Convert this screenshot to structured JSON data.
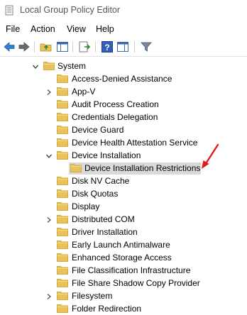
{
  "window": {
    "title": "Local Group Policy Editor"
  },
  "menu": [
    "File",
    "Action",
    "View",
    "Help"
  ],
  "toolbar": {
    "buttons": [
      "back-icon",
      "forward-icon",
      "up-folder-icon",
      "show-hide-tree-icon",
      "export-list-icon",
      "help-icon",
      "properties-pane-icon",
      "filter-icon"
    ]
  },
  "tree": {
    "root": {
      "label": "System",
      "expanded": true
    },
    "items": [
      {
        "label": "Access-Denied Assistance",
        "expandable": false
      },
      {
        "label": "App-V",
        "expandable": true
      },
      {
        "label": "Audit Process Creation",
        "expandable": false
      },
      {
        "label": "Credentials Delegation",
        "expandable": false
      },
      {
        "label": "Device Guard",
        "expandable": false
      },
      {
        "label": "Device Health Attestation Service",
        "expandable": false
      },
      {
        "label": "Device Installation",
        "expandable": true,
        "expanded": true
      },
      {
        "label": "Device Installation Restrictions",
        "child": true,
        "selected": true
      },
      {
        "label": "Disk NV Cache",
        "expandable": false
      },
      {
        "label": "Disk Quotas",
        "expandable": false
      },
      {
        "label": "Display",
        "expandable": false
      },
      {
        "label": "Distributed COM",
        "expandable": true
      },
      {
        "label": "Driver Installation",
        "expandable": false
      },
      {
        "label": "Early Launch Antimalware",
        "expandable": false
      },
      {
        "label": "Enhanced Storage Access",
        "expandable": false
      },
      {
        "label": "File Classification Infrastructure",
        "expandable": false
      },
      {
        "label": "File Share Shadow Copy Provider",
        "expandable": false
      },
      {
        "label": "Filesystem",
        "expandable": true
      },
      {
        "label": "Folder Redirection",
        "expandable": false
      }
    ]
  },
  "colors": {
    "folder": "#e8c25a",
    "folder_dark": "#d9a935",
    "selection": "#d9d9d9",
    "annotation_arrow": "#e31b1b"
  }
}
